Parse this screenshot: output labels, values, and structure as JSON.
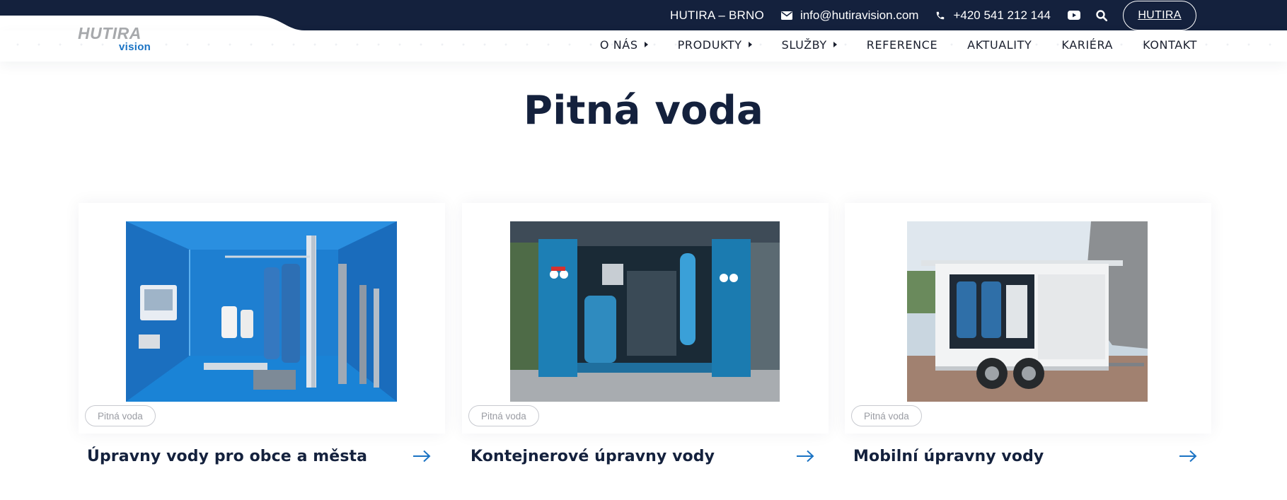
{
  "topbar": {
    "city": "HUTIRA – BRNO",
    "email": "info@hutiravision.com",
    "phone": "+420 541 212 144",
    "brand_button": "HUTIRA"
  },
  "logo": {
    "main": "HUTIRA",
    "sub": "vision"
  },
  "nav": {
    "items": [
      {
        "label": "O NÁS",
        "has_submenu": true
      },
      {
        "label": "PRODUKTY",
        "has_submenu": true
      },
      {
        "label": "SLUŽBY",
        "has_submenu": true
      },
      {
        "label": "REFERENCE",
        "has_submenu": false
      },
      {
        "label": "AKTUALITY",
        "has_submenu": false
      },
      {
        "label": "KARIÉRA",
        "has_submenu": false
      },
      {
        "label": "KONTAKT",
        "has_submenu": false
      }
    ]
  },
  "page": {
    "title": "Pitná voda"
  },
  "cards": [
    {
      "tag": "Pitná voda",
      "title": "Úpravny vody pro obce a města"
    },
    {
      "tag": "Pitná voda",
      "title": "Kontejnerové úpravny vody"
    },
    {
      "tag": "Pitná voda",
      "title": "Mobilní úpravny vody"
    }
  ],
  "colors": {
    "topbar_bg": "#14213d",
    "heading": "#14213d",
    "accent_blue": "#1a73c4",
    "tag_border": "#c8cad0"
  },
  "icons": {
    "email": "envelope-icon",
    "phone": "phone-icon",
    "youtube": "youtube-icon",
    "search": "search-icon",
    "arrow": "arrow-right-icon"
  }
}
